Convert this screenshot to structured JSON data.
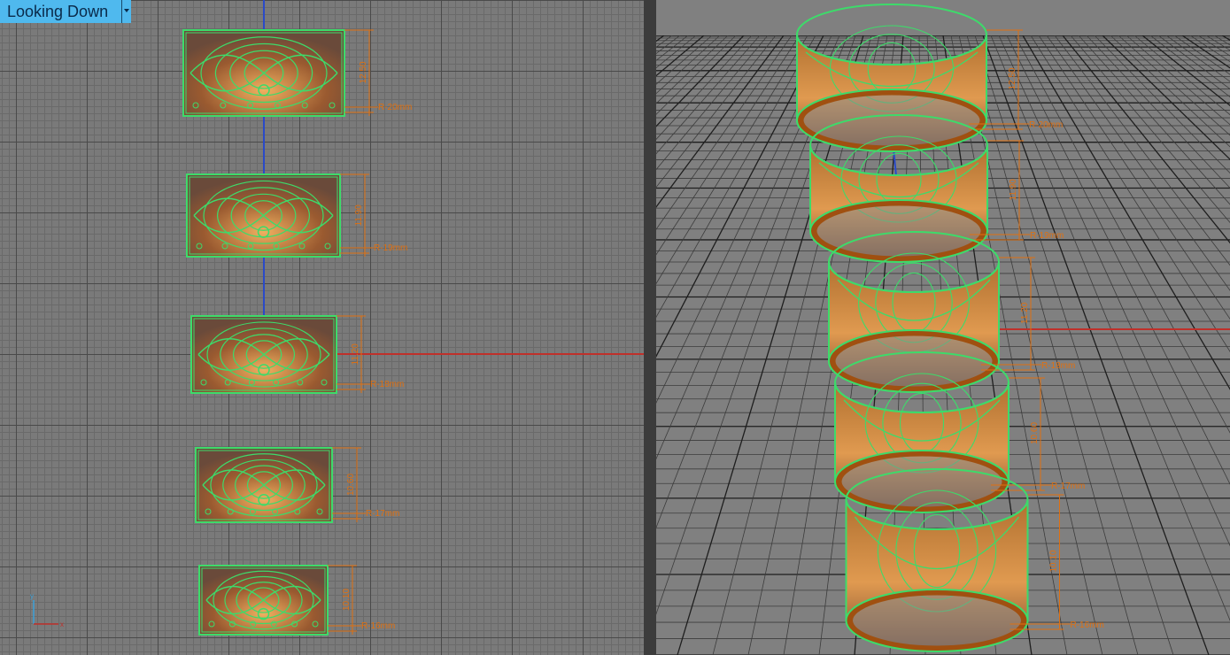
{
  "viewport_top": {
    "label": "Looking Down",
    "axis_x": "x",
    "axis_y": "y"
  },
  "rings": [
    {
      "height": "12.50",
      "radius": "R-20mm"
    },
    {
      "height": "11.90",
      "radius": "R-19mm"
    },
    {
      "height": "11.20",
      "radius": "R-18mm"
    },
    {
      "height": "10.60",
      "radius": "R-17mm"
    },
    {
      "height": "10.10",
      "radius": "R-16mm"
    }
  ],
  "colors": {
    "outline": "#3ddb6a",
    "body": "#c8742a",
    "dim": "#e07010",
    "axis_x": "#c0302a",
    "axis_y": "#2a4ac8"
  }
}
